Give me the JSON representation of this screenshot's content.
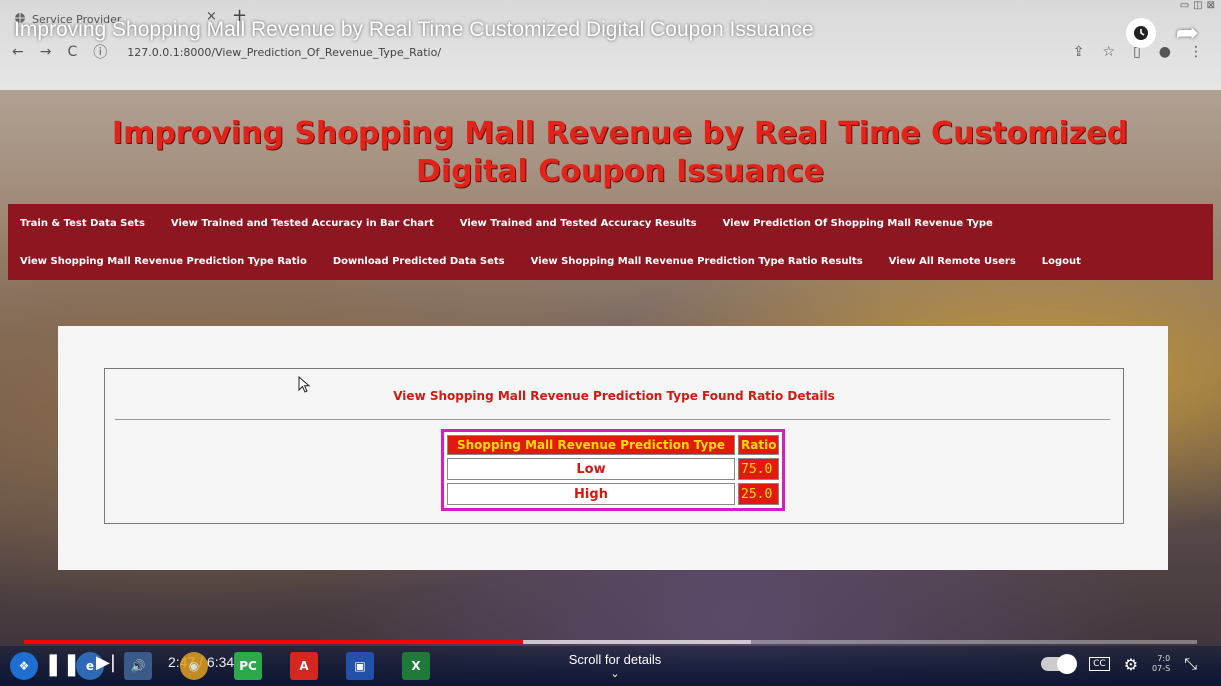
{
  "video": {
    "title": "Improving Shopping Mall Revenue by Real Time Customized Digital Coupon Issuance",
    "current_time": "2:47",
    "duration": "6:34",
    "progress": 0.425,
    "buffered": 0.62,
    "scroll_hint": "Scroll for details"
  },
  "browser": {
    "tab_title": "Service Provider",
    "url": "127.0.0.1:8000/View_Prediction_Of_Revenue_Type_Ratio/"
  },
  "site": {
    "heading": "Improving Shopping Mall Revenue by Real Time Customized Digital Coupon Issuance",
    "nav": {
      "row1": [
        "Train & Test Data Sets",
        "View Trained and Tested Accuracy in Bar Chart",
        "View Trained and Tested Accuracy Results",
        "View Prediction Of Shopping Mall Revenue Type"
      ],
      "row2": [
        "View Shopping Mall Revenue Prediction Type Ratio",
        "Download Predicted Data Sets",
        "View Shopping Mall Revenue Prediction Type Ratio Results",
        "View All Remote Users",
        "Logout"
      ]
    }
  },
  "ratio_details": {
    "heading": "View Shopping Mall Revenue Prediction Type Found Ratio Details",
    "columns": [
      "Shopping Mall Revenue Prediction Type",
      "Ratio"
    ],
    "rows": [
      {
        "type": "Low",
        "ratio": "75.0"
      },
      {
        "type": "High",
        "ratio": "25.0"
      }
    ]
  },
  "system": {
    "clock_time": "7:0",
    "clock_date": "07-S"
  },
  "colors": {
    "heading_red": "#e2231a",
    "nav_bg": "#8e1620",
    "table_header_bg": "#e3180f",
    "table_header_text": "#ffde00",
    "table_border": "#d81cc3",
    "progress": "#ff0000"
  },
  "icons": {
    "tab": "globe-icon",
    "back": "arrow-left-icon",
    "forward": "arrow-right-icon",
    "reload": "reload-icon",
    "info": "info-icon",
    "watch_later": "clock-icon",
    "share": "share-icon",
    "play_pause": "pause-icon",
    "next": "next-icon",
    "volume": "volume-icon",
    "settings": "gear-icon",
    "fullscreen": "fullscreen-exit-icon"
  }
}
